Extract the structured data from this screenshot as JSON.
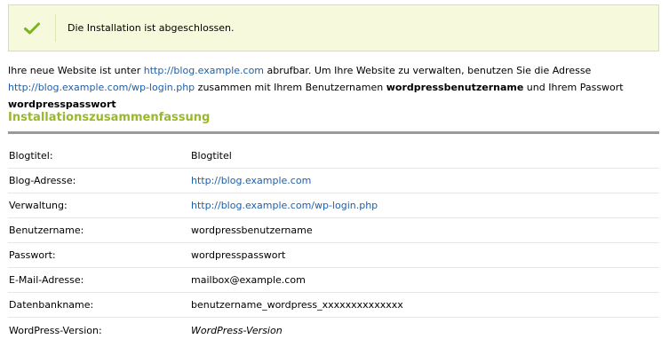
{
  "notice": {
    "icon": "checkmark-icon",
    "accent_color": "#7cb321",
    "text": "Die Installation ist abgeschlossen."
  },
  "intro": {
    "part1": "Ihre neue Website ist unter ",
    "site_url": "http://blog.example.com",
    "part2": " abrufbar. Um Ihre Website zu verwalten, benutzen Sie die Adresse ",
    "admin_url": "http://blog.example.com/wp-login.php",
    "part3": " zusammen mit Ihrem Benutzernamen ",
    "username": "wordpressbenutzername",
    "part4": " und Ihrem Passwort ",
    "password": "wordpresspasswort"
  },
  "summary": {
    "title": "Installationszusammenfassung",
    "title_color": "#9ab82b",
    "rows": [
      {
        "label": "Blogtitel:",
        "value": "Blogtitel"
      },
      {
        "label": "Blog-Adresse:",
        "value": "http://blog.example.com"
      },
      {
        "label": "Verwaltung:",
        "value": "http://blog.example.com/wp-login.php"
      },
      {
        "label": "Benutzername:",
        "value": "wordpressbenutzername"
      },
      {
        "label": "Passwort:",
        "value": "wordpresspasswort"
      },
      {
        "label": "E-Mail-Adresse:",
        "value": "mailbox@example.com"
      },
      {
        "label": "Datenbankname:",
        "value": "benutzername_wordpress_xxxxxxxxxxxxxx"
      },
      {
        "label": "WordPress-Version:",
        "value": "WordPress-Version"
      }
    ]
  }
}
